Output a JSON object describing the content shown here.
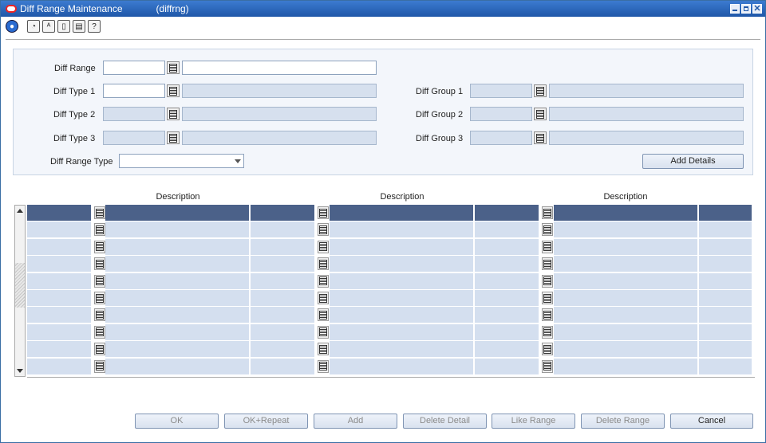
{
  "window": {
    "title": "Diff Range Maintenance",
    "code": "(diffrng)"
  },
  "toolbar": {
    "icons": [
      "globe-icon",
      "help-icon",
      "spellcheck-icon",
      "clipboard-icon",
      "print-icon",
      "question-icon"
    ]
  },
  "form": {
    "diff_range_label": "Diff Range",
    "diff_type_1_label": "Diff Type 1",
    "diff_type_2_label": "Diff Type 2",
    "diff_type_3_label": "Diff Type 3",
    "diff_group_1_label": "Diff Group 1",
    "diff_group_2_label": "Diff Group 2",
    "diff_group_3_label": "Diff Group 3",
    "diff_range_type_label": "Diff Range Type",
    "diff_range_type_value": "",
    "add_details_label": "Add Details"
  },
  "grid": {
    "headers": [
      "Description",
      "Description",
      "Description"
    ],
    "row_count": 10,
    "selected_row": 0
  },
  "footer": {
    "ok": "OK",
    "ok_repeat": "OK+Repeat",
    "add": "Add",
    "delete_detail": "Delete Detail",
    "like_range": "Like Range",
    "delete_range": "Delete Range",
    "cancel": "Cancel"
  },
  "colors": {
    "titlebar": "#1f57a8",
    "selected_row": "#4b6189",
    "row": "#d4dfef"
  }
}
